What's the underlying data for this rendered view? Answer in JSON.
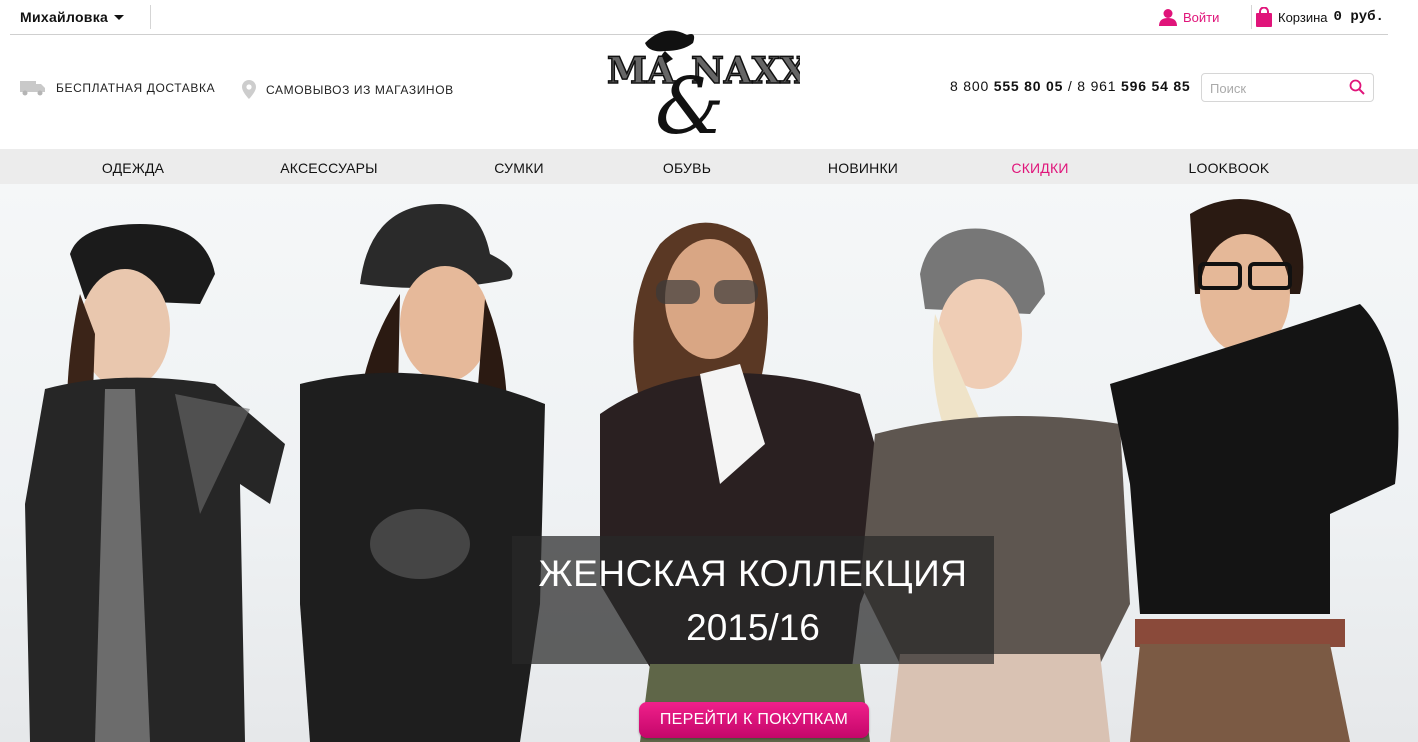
{
  "topbar": {
    "city": "Михайловка",
    "login_label": "Войти",
    "cart_label": "Корзина",
    "cart_sum": "0 руб."
  },
  "header": {
    "delivery_label": "БЕСПЛАТНАЯ ДОСТАВКА",
    "pickup_label": "САМОВЫВОЗ ИЗ МАГАЗИНОВ",
    "logo_text_left": "MA",
    "logo_text_right": "NAXX",
    "logo_ampersand": "&",
    "phone1_prefix": "8 800 ",
    "phone1_main": "555 80 05",
    "phone_sep": " / ",
    "phone2_prefix": "8 961 ",
    "phone2_main": "596 54 85",
    "search_placeholder": "Поиск"
  },
  "nav": {
    "items": [
      {
        "label": "ОДЕЖДА"
      },
      {
        "label": "АКСЕССУАРЫ"
      },
      {
        "label": "СУМКИ"
      },
      {
        "label": "ОБУВЬ"
      },
      {
        "label": "НОВИНКИ"
      },
      {
        "label": "СКИДКИ"
      },
      {
        "label": "LOOKBOOK"
      }
    ]
  },
  "hero": {
    "title_line1": "ЖЕНСКАЯ КОЛЛЕКЦИЯ",
    "title_line2": "2015/16",
    "cta_label": "ПЕРЕЙТИ К ПОКУПКАМ"
  },
  "colors": {
    "accent": "#e0147a",
    "nav_bg": "#ececec",
    "caption_bg": "#282828"
  },
  "icons": {
    "delivery": "truck-icon",
    "pickup": "location-pin-icon",
    "login": "user-icon",
    "cart": "shopping-bag-icon",
    "search": "search-icon",
    "city_dropdown": "chevron-down-icon"
  }
}
